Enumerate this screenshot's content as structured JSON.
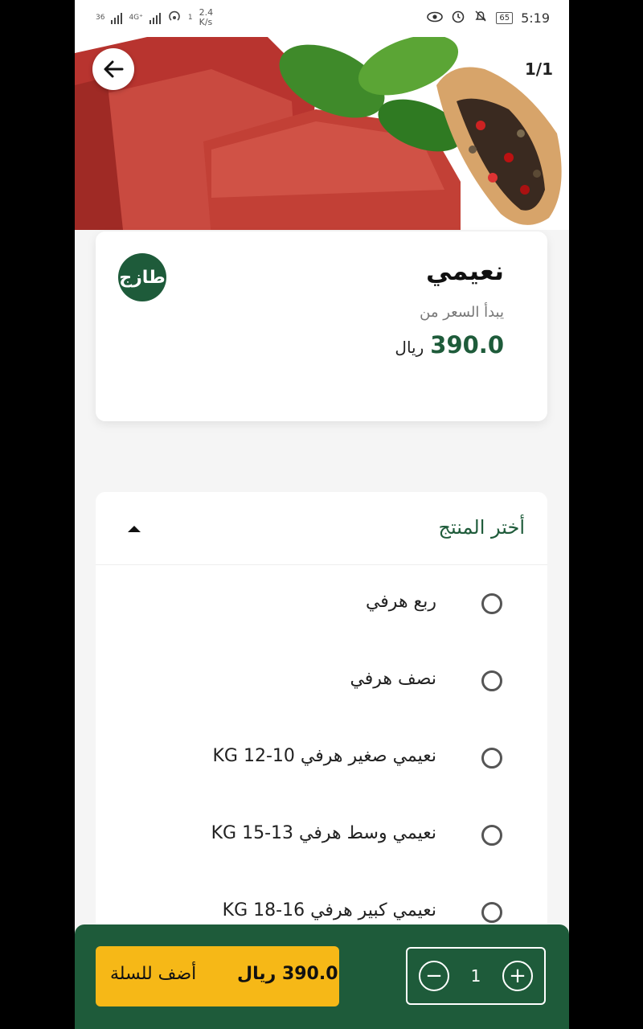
{
  "status_bar": {
    "signal1": "36",
    "signal2": "4G⁺",
    "hotspot_count": "1",
    "speed_value": "2.4",
    "speed_unit": "K/s",
    "battery": "65",
    "time": "5:19"
  },
  "hero": {
    "counter": "1/1"
  },
  "product": {
    "name": "نعيمي",
    "price_from_label": "يبدأ السعر من",
    "price": "390.0",
    "currency": "ريال",
    "logo_text": "طازج"
  },
  "options": {
    "title": "أختر المنتج",
    "items": [
      {
        "label": "ربع هرفي"
      },
      {
        "label": "نصف هرفي"
      },
      {
        "label": "نعيمي صغير هرفي 10-12 KG"
      },
      {
        "label": "نعيمي وسط هرفي 13-15 KG"
      },
      {
        "label": "نعيمي كبير هرفي 16-18 KG"
      }
    ]
  },
  "cart": {
    "quantity": "1",
    "total_price": "390.0 ريال",
    "add_label": "أضف للسلة"
  },
  "colors": {
    "brand_green": "#1e5b3a",
    "accent_yellow": "#f6b817"
  },
  "icons": [
    "back-arrow-icon",
    "caret-up-icon",
    "minus-icon",
    "plus-icon",
    "eye-icon",
    "alarm-icon",
    "mute-icon"
  ]
}
